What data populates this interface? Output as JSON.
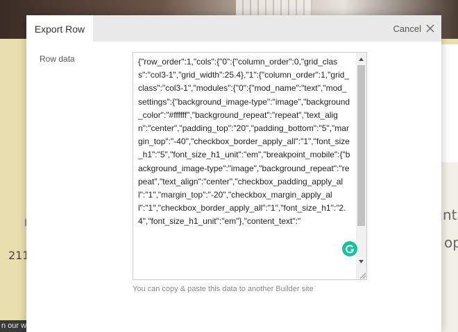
{
  "background": {
    "number_211": "211",
    "bottom_left_text": "n our w",
    "right_text_1": "nta",
    "right_text_2": "op"
  },
  "modal": {
    "tab_title": "Export Row",
    "cancel_label": "Cancel",
    "cancel_icon": "close-icon",
    "row_data_label": "Row data",
    "row_data_value": "{\"row_order\":1,\"cols\":{\"0\":{\"column_order\":0,\"grid_class\":\"col3-1\",\"grid_width\":25.4},\"1\":{\"column_order\":1,\"grid_class\":\"col3-1\",\"modules\":{\"0\":{\"mod_name\":\"text\",\"mod_settings\":{\"background_image-type\":\"image\",\"background_color\":\"#ffffff\",\"background_repeat\":\"repeat\",\"text_align\":\"center\",\"padding_top\":\"20\",\"padding_bottom\":\"5\",\"margin_top\":\"-40\",\"checkbox_border_apply_all\":\"1\",\"font_size_h1\":\"5\",\"font_size_h1_unit\":\"em\",\"breakpoint_mobile\":{\"background_image-type\":\"image\",\"background_repeat\":\"repeat\",\"text_align\":\"center\",\"checkbox_padding_apply_all\":\"1\",\"margin_top\":\"-20\",\"checkbox_margin_apply_all\":\"1\",\"checkbox_border_apply_all\":\"1\",\"font_size_h1\":\"2.4\",\"font_size_h1_unit\":\"em\"},\"content_text\":\"",
    "help_text": "You can copy & paste this data to another Builder site"
  },
  "colors": {
    "page_background": "#e9dfae",
    "modal_header": "#e9e9e9",
    "grammarly": "#15c39a"
  }
}
